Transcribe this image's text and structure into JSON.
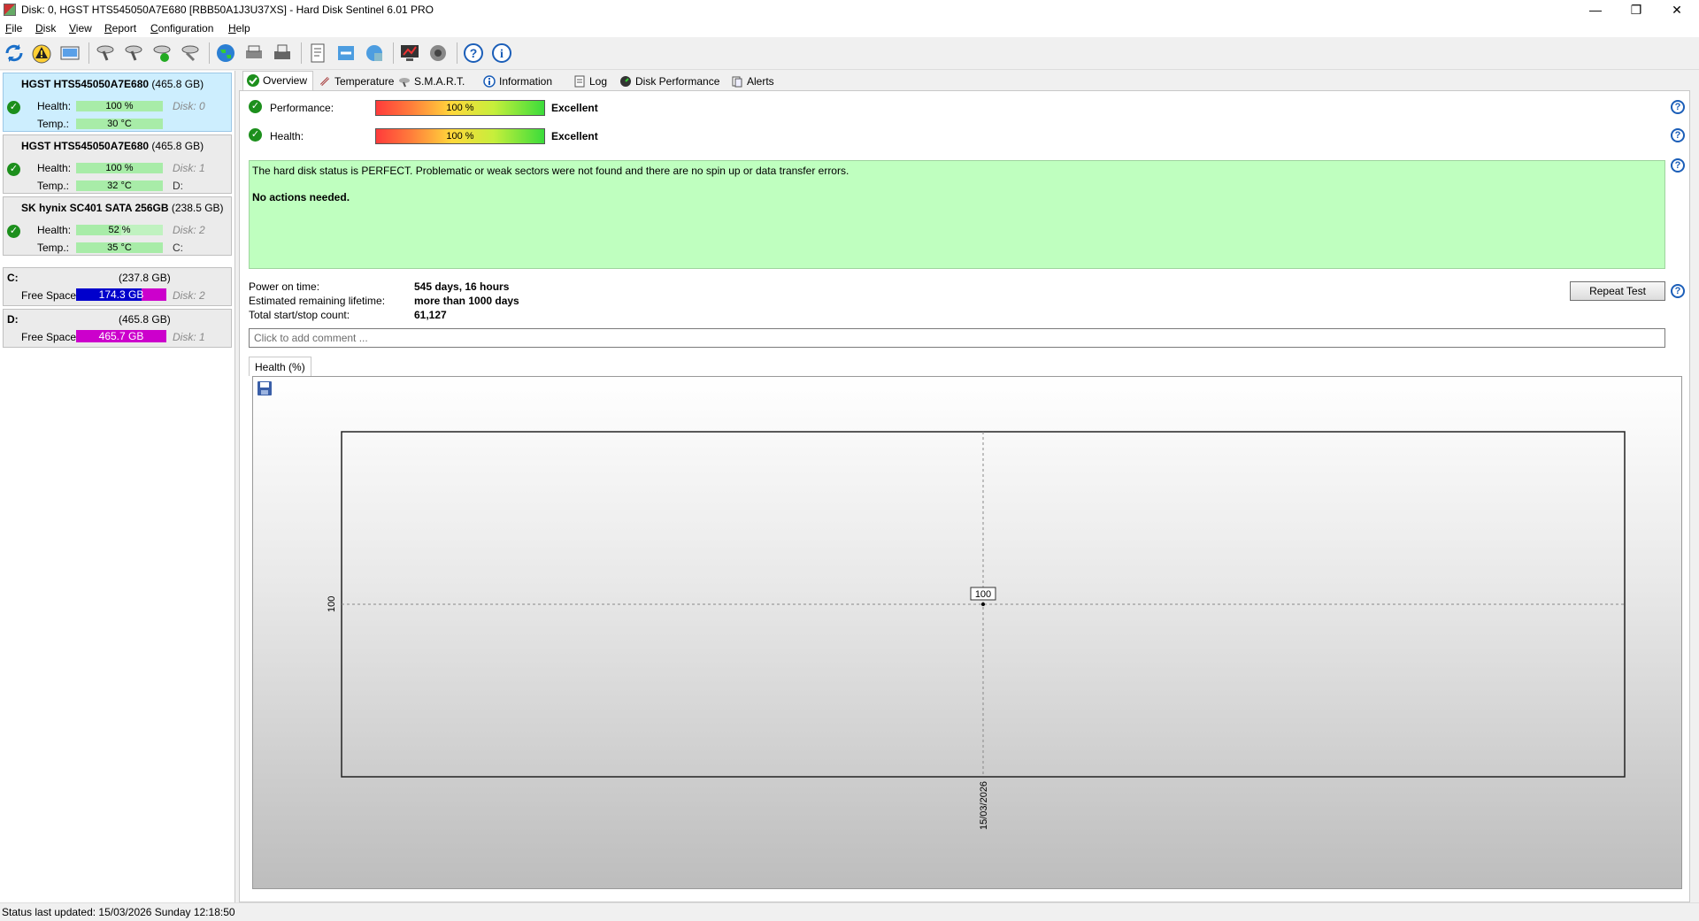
{
  "window": {
    "title": "Disk: 0, HGST HTS545050A7E680 [RBB50A1J3U37XS]  -  Hard Disk Sentinel 6.01 PRO",
    "min": "—",
    "max": "❐",
    "close": "✕"
  },
  "menu": [
    {
      "accel": "F",
      "rest": "ile"
    },
    {
      "accel": "D",
      "rest": "isk"
    },
    {
      "accel": "V",
      "rest": "iew"
    },
    {
      "accel": "R",
      "rest": "eport"
    },
    {
      "accel": "C",
      "rest": "onfiguration"
    },
    {
      "accel": "H",
      "rest": "elp"
    }
  ],
  "disks": [
    {
      "name": "HGST HTS545050A7E680",
      "size": "(465.8 GB)",
      "health_label": "Health:",
      "health": "100 %",
      "health_fraction": 1.0,
      "temp_label": "Temp.:",
      "temp": "30 °C",
      "disk": "Disk: 0",
      "letter": ""
    },
    {
      "name": "HGST HTS545050A7E680",
      "size": "(465.8 GB)",
      "health_label": "Health:",
      "health": "100 %",
      "health_fraction": 1.0,
      "temp_label": "Temp.:",
      "temp": "32 °C",
      "disk": "Disk: 1",
      "letter": "D:"
    },
    {
      "name": "SK hynix SC401 SATA 256GB",
      "size": "(238.5 GB)",
      "health_label": "Health:",
      "health": "52 %",
      "health_fraction": 0.52,
      "temp_label": "Temp.:",
      "temp": "35 °C",
      "disk": "Disk: 2",
      "letter": "C:"
    }
  ],
  "volumes": [
    {
      "letter": "C:",
      "size": "(237.8 GB)",
      "free_label": "Free Space",
      "free": "174.3 GB",
      "free_fraction": 0.73,
      "color": "#0000cc",
      "disk": "Disk: 2"
    },
    {
      "letter": "D:",
      "size": "(465.8 GB)",
      "free_label": "Free Space",
      "free": "465.7 GB",
      "free_fraction": 1.0,
      "color": "#cc00cc",
      "disk": "Disk: 1"
    }
  ],
  "tabs": [
    "Overview",
    "Temperature",
    "S.M.A.R.T.",
    "Information",
    "Log",
    "Disk Performance",
    "Alerts"
  ],
  "overview": {
    "performance_label": "Performance:",
    "performance_value": "100 %",
    "performance_rating": "Excellent",
    "health_label": "Health:",
    "health_value": "100 %",
    "health_rating": "Excellent",
    "status_text": "The hard disk status is PERFECT. Problematic or weak sectors were not found and there are no spin up or data transfer errors.",
    "status_action": "No actions needed.",
    "power_on_label": "Power on time:",
    "power_on_value": "545 days, 16 hours",
    "lifetime_label": "Estimated remaining lifetime:",
    "lifetime_value": "more than 1000 days",
    "startstop_label": "Total start/stop count:",
    "startstop_value": "61,127",
    "repeat_test": "Repeat Test",
    "comment_placeholder": "Click to add comment ..."
  },
  "chart_tab": "Health (%)",
  "chart_data": {
    "type": "line",
    "x": [
      "15/03/2026"
    ],
    "series": [
      {
        "values": [
          100
        ]
      }
    ],
    "ytick": "100",
    "data_label": "100",
    "xlabel": "",
    "ylabel": "",
    "grid": true
  },
  "statusbar": "Status last updated: 15/03/2026 Sunday 12:18:50"
}
